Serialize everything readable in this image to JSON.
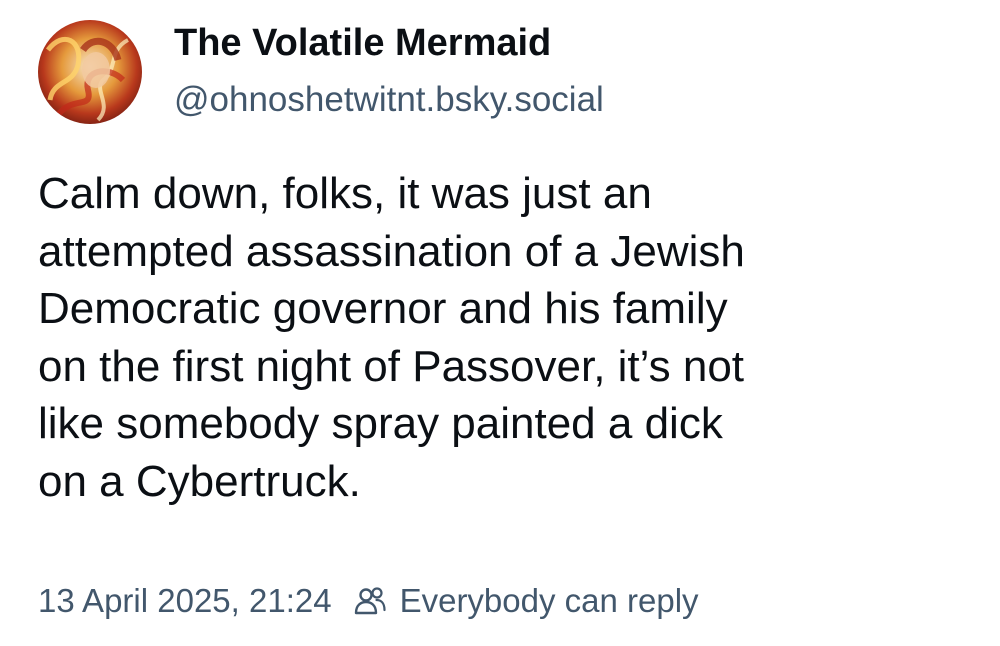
{
  "post": {
    "author": {
      "display_name": "The Volatile Mermaid",
      "handle": "@ohnoshetwitnt.bsky.social"
    },
    "text_lines": [
      "Calm down, folks, it was just an",
      "attempted assassination of a Jewish",
      "Democratic governor and his family",
      "on the first night of Passover, it’s not",
      "like somebody spray painted a dick",
      "on a Cybertruck."
    ],
    "timestamp": "13 April 2025, 21:24",
    "reply_setting": "Everybody can reply",
    "icons": {
      "avatar": "avatar-image",
      "reply_setting": "people-icon"
    },
    "colors": {
      "text": "#0b0f14",
      "secondary": "#42576c",
      "background": "#ffffff"
    }
  }
}
